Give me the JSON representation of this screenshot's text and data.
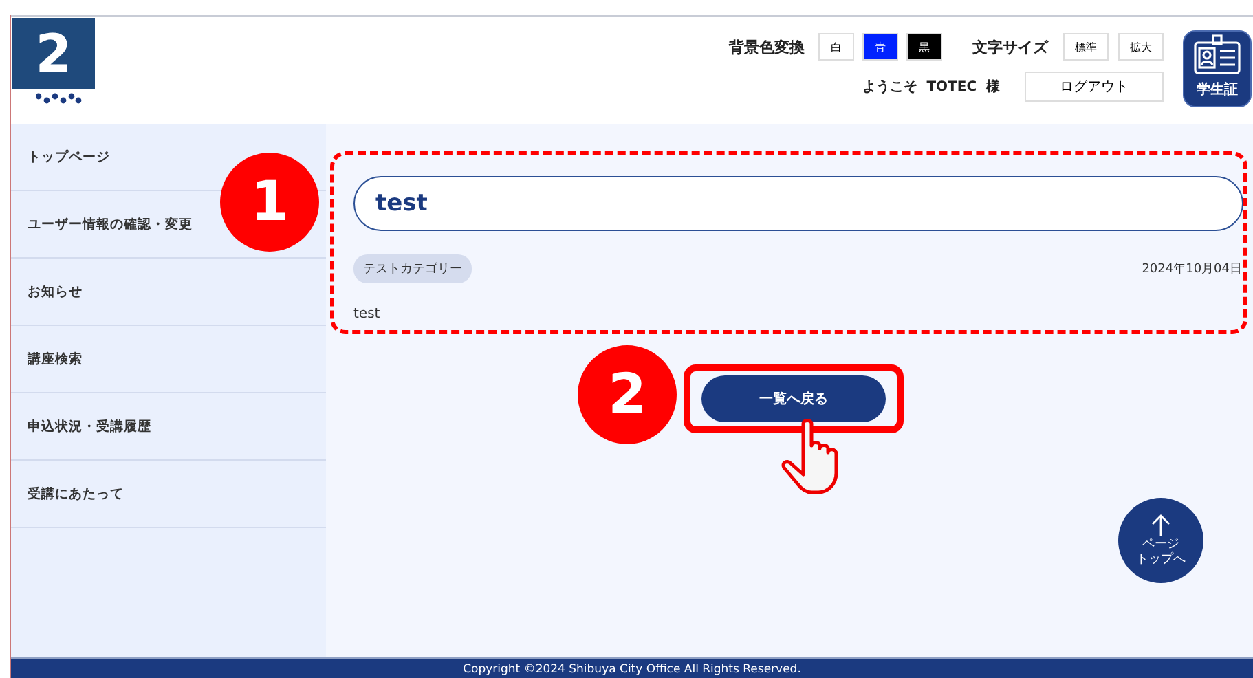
{
  "step_badge": "2",
  "header": {
    "bg_label": "背景色変換",
    "bg_options": [
      {
        "label": "白",
        "color": "#ffffff"
      },
      {
        "label": "青",
        "color": "#0022ff"
      },
      {
        "label": "黒",
        "color": "#000000"
      }
    ],
    "size_label": "文字サイズ",
    "size_options": [
      "標準",
      "拡大"
    ],
    "welcome": "ようこそ  TOTEC  様",
    "logout": "ログアウト",
    "student_card": "学生証"
  },
  "sidebar": {
    "items": [
      "トップページ",
      "ユーザー情報の確認・変更",
      "お知らせ",
      "講座検索",
      "申込状況・受講履歴",
      "受講にあたって"
    ]
  },
  "notice": {
    "title": "test",
    "category": "テストカテゴリー",
    "date": "2024年10月04日",
    "body": "test"
  },
  "back_button": "一覧へ戻る",
  "markers": [
    "1",
    "2"
  ],
  "page_top": [
    "ページ",
    "トップへ"
  ],
  "footer": "Copyright ©2024 Shibuya City Office All Rights Reserved."
}
